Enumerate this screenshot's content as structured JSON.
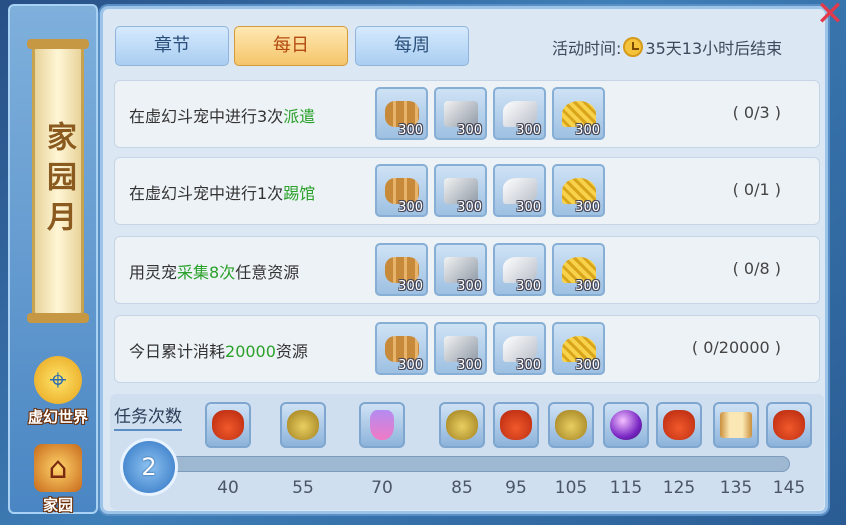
{
  "side": {
    "title": "家园月",
    "nav": [
      {
        "label": "虚幻世界",
        "icon": "globe-pin-icon"
      },
      {
        "label": "家园",
        "icon": "house-icon"
      }
    ]
  },
  "tabs": [
    {
      "label": "章节",
      "active": false
    },
    {
      "label": "每日",
      "active": true
    },
    {
      "label": "每周",
      "active": false
    }
  ],
  "activity": {
    "label": "活动时间:",
    "remaining": "35天13小时后结束"
  },
  "tasks": [
    {
      "text_prefix": "在虚幻斗宠中进行3次",
      "text_highlight": "派遣",
      "text_suffix": "",
      "progress": "( 0/3 )",
      "rewards": [
        {
          "type": "wood",
          "count": "300"
        },
        {
          "type": "iron",
          "count": "300"
        },
        {
          "type": "stone",
          "count": "300"
        },
        {
          "type": "grain",
          "count": "300"
        }
      ]
    },
    {
      "text_prefix": "在虚幻斗宠中进行1次",
      "text_highlight": "踢馆",
      "text_suffix": "",
      "progress": "( 0/1 )",
      "rewards": [
        {
          "type": "wood",
          "count": "300"
        },
        {
          "type": "iron",
          "count": "300"
        },
        {
          "type": "stone",
          "count": "300"
        },
        {
          "type": "grain",
          "count": "300"
        }
      ]
    },
    {
      "text_prefix": "用灵宠",
      "text_highlight": "采集8次",
      "text_suffix": "任意资源",
      "progress": "( 0/8 )",
      "rewards": [
        {
          "type": "wood",
          "count": "300"
        },
        {
          "type": "iron",
          "count": "300"
        },
        {
          "type": "stone",
          "count": "300"
        },
        {
          "type": "grain",
          "count": "300"
        }
      ]
    },
    {
      "text_prefix": "今日累计消耗",
      "text_highlight": "20000",
      "text_suffix": "资源",
      "progress": "( 0/20000 )",
      "rewards": [
        {
          "type": "wood",
          "count": "300"
        },
        {
          "type": "iron",
          "count": "300"
        },
        {
          "type": "stone",
          "count": "300"
        },
        {
          "type": "grain",
          "count": "300"
        }
      ]
    }
  ],
  "progress": {
    "label": "任务次数",
    "current": "2",
    "fill_fraction": 0.0,
    "milestones": [
      {
        "value": "40",
        "reward": "gift-bag-red"
      },
      {
        "value": "55",
        "reward": "gift-bag-gold"
      },
      {
        "value": "70",
        "reward": "gift-potion"
      },
      {
        "value": "85",
        "reward": "gift-bag-gold"
      },
      {
        "value": "95",
        "reward": "gift-bag-red"
      },
      {
        "value": "105",
        "reward": "gift-bag-gold"
      },
      {
        "value": "115",
        "reward": "gift-orb"
      },
      {
        "value": "125",
        "reward": "gift-bag-red"
      },
      {
        "value": "135",
        "reward": "gift-scroll"
      },
      {
        "value": "145",
        "reward": "gift-bag-red"
      }
    ]
  },
  "colors": {
    "highlight": "#2aa12a",
    "active_tab": "#f5c56a",
    "close": "#e23a4a"
  }
}
